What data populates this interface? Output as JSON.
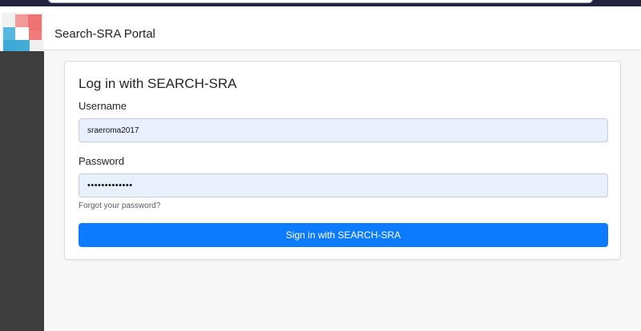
{
  "header": {
    "portal_title": "Search-SRA Portal",
    "logo_icon": "logo-icon"
  },
  "login": {
    "title": "Log in with SEARCH-SRA",
    "username_label": "Username",
    "username_value": "sraeroma2017",
    "password_label": "Password",
    "password_value": "•••••••••••••",
    "forgot_link": "Forgot your password?",
    "signin_button": "Sign in with SEARCH-SRA"
  },
  "colors": {
    "accent": "#0d7bff",
    "sidebar": "#3d3d3d",
    "input_fill": "#e8f0fe"
  }
}
